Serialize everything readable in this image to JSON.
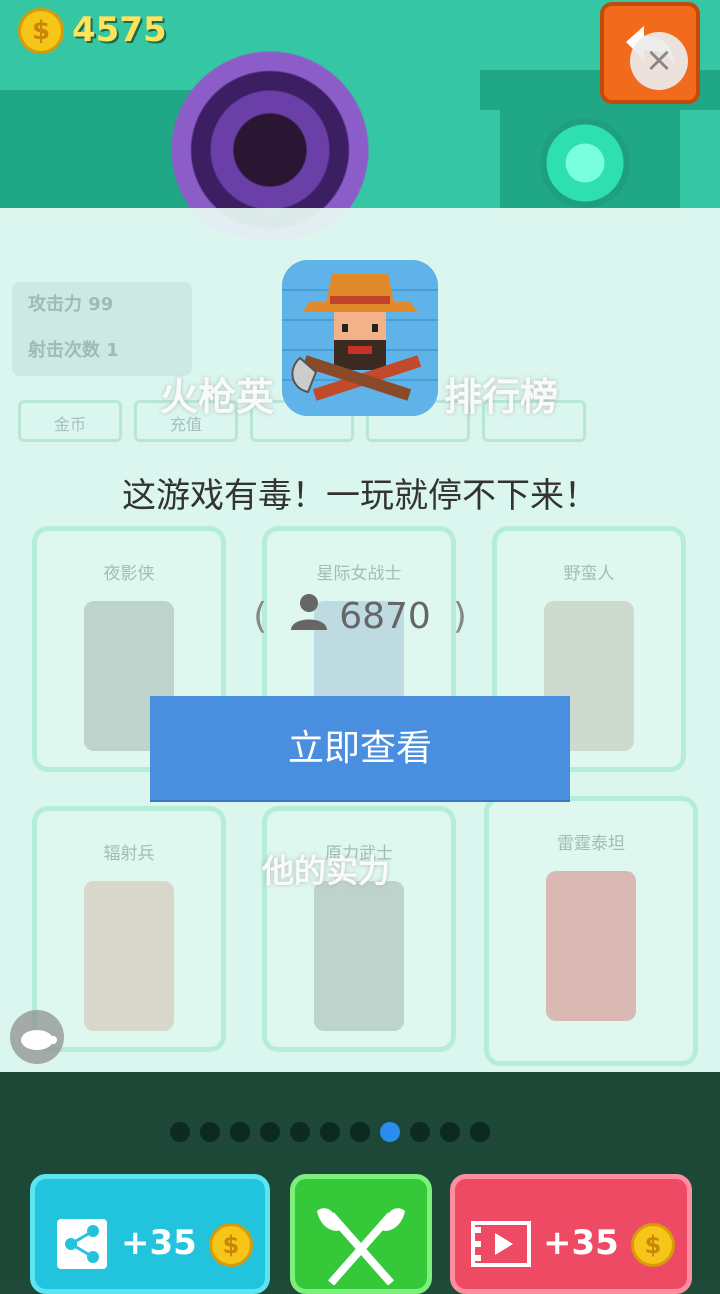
{
  "top": {
    "coin_symbol": "$",
    "coins": "4575",
    "close_symbol": "×"
  },
  "background": {
    "attack_label": "攻击力 99",
    "shots_label": "射击次数  1",
    "tabs": [
      "金币",
      "充值",
      "...",
      "...",
      "..."
    ],
    "leaderboard_title_left": "火枪英",
    "leaderboard_title_right": "排行榜",
    "strength_title": "他的实力",
    "cards": [
      {
        "name": "夜影侠"
      },
      {
        "name": "星际女战士"
      },
      {
        "name": "野蛮人"
      },
      {
        "name": "辐射兵"
      },
      {
        "name": "原力武士"
      },
      {
        "name": "雷霆泰坦"
      }
    ]
  },
  "promo": {
    "tagline": "这游戏有毒！一玩就停不下来！",
    "paren_open": "(",
    "paren_close": ")",
    "player_count": "6870",
    "cta_label": "立即查看"
  },
  "pager": {
    "total": 11,
    "active_index": 7
  },
  "bottom_buttons": {
    "share_reward": "+35",
    "video_reward": "+35",
    "coin_symbol": "$"
  },
  "colors": {
    "accent_blue": "#4a8ee0",
    "share_cyan": "#22c3dc",
    "axe_green": "#35c93a",
    "video_red": "#ef4a63",
    "orange": "#f26b1d"
  }
}
